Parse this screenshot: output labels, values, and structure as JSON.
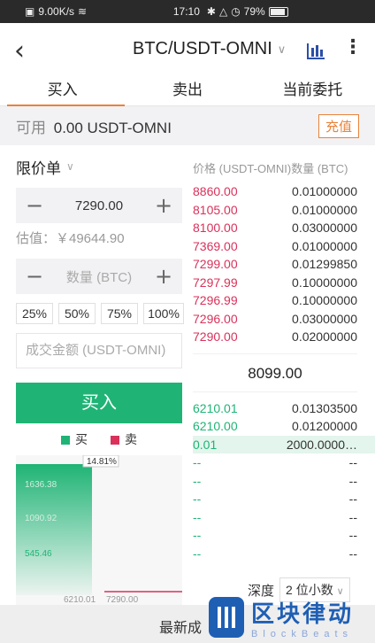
{
  "status_bar": {
    "network_speed": "9.00K/s",
    "time": "17:10",
    "battery": "79%"
  },
  "header": {
    "title": "BTC/USDT-OMNI"
  },
  "tabs": [
    {
      "label": "买入"
    },
    {
      "label": "卖出"
    },
    {
      "label": "当前委托"
    }
  ],
  "balance": {
    "label": "可用",
    "value": "0.00 USDT-OMNI",
    "deposit_label": "充值"
  },
  "order_form": {
    "order_type": "限价单",
    "price": "7290.00",
    "estimate": "估值：￥49644.90",
    "quantity_placeholder": "数量 (BTC)",
    "percentages": [
      "25%",
      "50%",
      "75%",
      "100%"
    ],
    "amount_placeholder": "成交金额 (USDT-OMNI)",
    "submit_label": "买入"
  },
  "depth_chart": {
    "legend_buy": "买",
    "legend_sell": "卖",
    "tooltip": "14.81%",
    "y_labels": [
      "1636.38",
      "1090.92",
      "545.46"
    ],
    "x_labels": [
      "6210.01",
      "7290.00"
    ],
    "colors": {
      "buy": "#1fb475",
      "sell": "#d9315a"
    }
  },
  "orderbook": {
    "header": "价格 (USDT-OMNI)数量 (BTC)",
    "asks": [
      {
        "price": "8860.00",
        "qty": "0.01000000"
      },
      {
        "price": "8105.00",
        "qty": "0.01000000"
      },
      {
        "price": "8100.00",
        "qty": "0.03000000"
      },
      {
        "price": "7369.00",
        "qty": "0.01000000"
      },
      {
        "price": "7299.00",
        "qty": "0.01299850"
      },
      {
        "price": "7297.99",
        "qty": "0.10000000"
      },
      {
        "price": "7296.99",
        "qty": "0.10000000"
      },
      {
        "price": "7296.00",
        "qty": "0.03000000"
      },
      {
        "price": "7290.00",
        "qty": "0.02000000"
      }
    ],
    "last_price": "8099.00",
    "bids": [
      {
        "price": "6210.01",
        "qty": "0.01303500"
      },
      {
        "price": "6210.00",
        "qty": "0.01200000"
      },
      {
        "price": "0.01",
        "qty": "2000.0000…"
      },
      {
        "price": "--",
        "qty": "--"
      },
      {
        "price": "--",
        "qty": "--"
      },
      {
        "price": "--",
        "qty": "--"
      },
      {
        "price": "--",
        "qty": "--"
      },
      {
        "price": "--",
        "qty": "--"
      },
      {
        "price": "--",
        "qty": "--"
      }
    ],
    "depth_label": "深度",
    "depth_value": "2 位小数"
  },
  "bottom_bar": {
    "label": "最新成"
  },
  "watermark": {
    "text_cn": "区块律动",
    "text_en": "BlockBeats"
  }
}
